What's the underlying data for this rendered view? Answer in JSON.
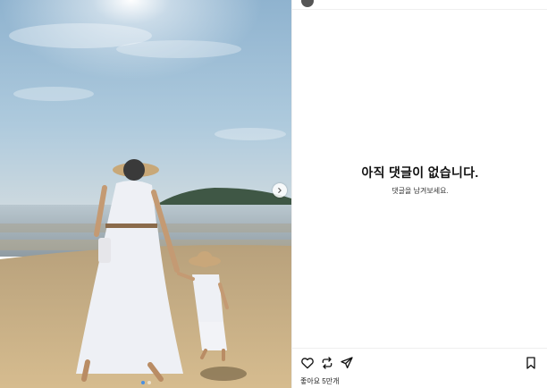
{
  "post": {
    "likes_text": "좋아요 5만개",
    "carousel": {
      "total_slides": 2,
      "active_index": 0
    }
  },
  "comments": {
    "empty_title": "아직 댓글이 없습니다.",
    "empty_subtitle": "댓글을 남겨보세요."
  },
  "icons": {
    "like": "heart-icon",
    "repost": "repost-icon",
    "share": "send-icon",
    "save": "bookmark-icon",
    "next": "chevron-right-icon"
  },
  "colors": {
    "sky": "#9fbfd8",
    "sea": "#9aa9b3",
    "sand": "#cdb287",
    "hill": "#3f5745",
    "dress": "#eef0f5",
    "active_dot": "#4a90e2"
  }
}
